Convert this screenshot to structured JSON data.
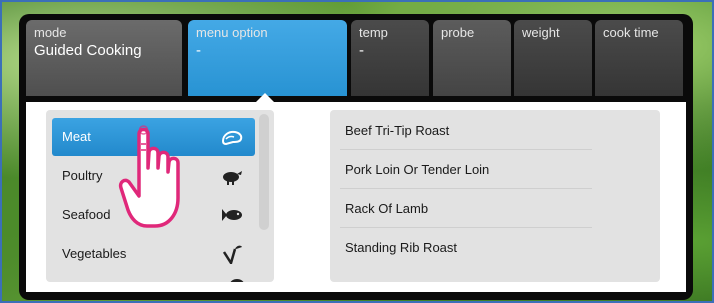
{
  "tabs": [
    {
      "key": "mode",
      "value": "Guided Cooking"
    },
    {
      "key": "menu option",
      "value": "-"
    },
    {
      "key": "temp",
      "value": "-"
    },
    {
      "key": "probe",
      "value": ""
    },
    {
      "key": "weight",
      "value": ""
    },
    {
      "key": "cook time",
      "value": ""
    }
  ],
  "categories": [
    {
      "label": "Meat",
      "icon": "steak-icon",
      "selected": true
    },
    {
      "label": "Poultry",
      "icon": "turkey-icon",
      "selected": false
    },
    {
      "label": "Seafood",
      "icon": "fish-icon",
      "selected": false
    },
    {
      "label": "Vegetables",
      "icon": "sprout-icon",
      "selected": false
    }
  ],
  "menu_options": [
    "Beef Tri-Tip Roast",
    "Pork Loin Or Tender Loin",
    "Rack Of Lamb",
    "Standing Rib Roast"
  ],
  "colors": {
    "accent": "#2893d3",
    "hand_outline": "#e0287a"
  }
}
